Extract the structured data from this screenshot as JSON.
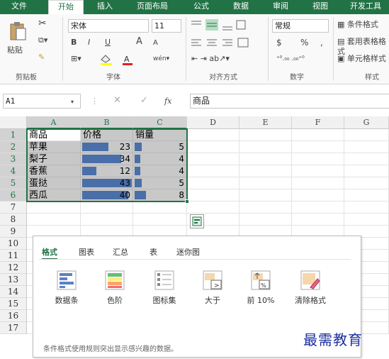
{
  "tabs": [
    "文件",
    "开始",
    "插入",
    "页面布局",
    "公式",
    "数据",
    "审阅",
    "视图",
    "开发工具"
  ],
  "ribbon": {
    "paste": "粘贴",
    "clipboard_label": "剪贴板",
    "font_name": "宋体",
    "font_size": "11",
    "bold": "B",
    "italic": "I",
    "underline": "U",
    "grow": "A",
    "shrink": "A",
    "font_label": "字体",
    "align_label": "对齐方式",
    "number_format": "常规",
    "currency": "$",
    "percent": "%",
    "comma": ",",
    "number_label": "数字",
    "cond_format": "条件格式",
    "table_format": "套用表格格式",
    "cell_style": "单元格样式",
    "styles_label": "样式"
  },
  "formula_bar": {
    "name_box": "A1",
    "fx": "fx",
    "content": "商品"
  },
  "columns": [
    "A",
    "B",
    "C",
    "D",
    "E",
    "F",
    "G"
  ],
  "rows": [
    "1",
    "2",
    "3",
    "4",
    "5",
    "6",
    "7",
    "8",
    "9",
    "10",
    "11",
    "12",
    "13",
    "14",
    "15",
    "16",
    "17"
  ],
  "table": {
    "headers": [
      "商品",
      "价格",
      "销量"
    ],
    "rows": [
      {
        "name": "苹果",
        "price": 23,
        "sales": 5
      },
      {
        "name": "梨子",
        "price": 34,
        "sales": 4
      },
      {
        "name": "香蕉",
        "price": 12,
        "sales": 4
      },
      {
        "name": "蛋挞",
        "price": 43,
        "sales": 5
      },
      {
        "name": "西瓜",
        "price": 40,
        "sales": 8
      }
    ]
  },
  "quick_analysis": {
    "tabs": [
      "格式",
      "图表",
      "汇总",
      "表",
      "迷你图"
    ],
    "items": [
      {
        "label": "数据条",
        "icon": "data-bars-icon"
      },
      {
        "label": "色阶",
        "icon": "color-scale-icon"
      },
      {
        "label": "图标集",
        "icon": "icon-set-icon"
      },
      {
        "label": "大于",
        "icon": "greater-than-icon"
      },
      {
        "label": "前 10%",
        "icon": "top-10-icon"
      },
      {
        "label": "清除格式",
        "icon": "clear-format-icon"
      }
    ],
    "description": "条件格式使用规则突出显示感兴趣的数据。"
  },
  "watermark": "最需教育",
  "colors": {
    "accent": "#217346",
    "databar": "#4a6ea8",
    "selection": "#c8c8c8"
  }
}
